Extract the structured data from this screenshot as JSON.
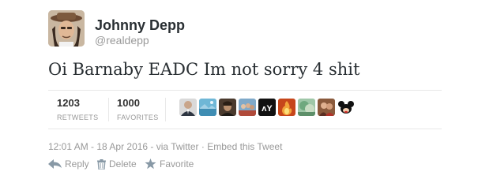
{
  "author": {
    "display_name": "Johnny Depp",
    "username": "@realdepp"
  },
  "tweet": {
    "text": "Oi Barnaby EADC Im not sorry 4 shit"
  },
  "stats": {
    "retweets_count": "1203",
    "retweets_label": "RETWEETS",
    "favorites_count": "1000",
    "favorites_label": "FAVORITES"
  },
  "facepile": [
    {
      "name": "face-avatar-1"
    },
    {
      "name": "face-avatar-2"
    },
    {
      "name": "face-avatar-3"
    },
    {
      "name": "face-avatar-4"
    },
    {
      "name": "face-avatar-5",
      "text": "ʌY"
    },
    {
      "name": "face-avatar-6"
    },
    {
      "name": "face-avatar-7"
    },
    {
      "name": "face-avatar-8"
    },
    {
      "name": "face-avatar-9"
    }
  ],
  "meta": {
    "timestamp": "12:01 AM - 18 Apr 2016",
    "via": " - via ",
    "source": "Twitter",
    "separator": " · ",
    "embed": "Embed this Tweet"
  },
  "actions": {
    "reply": "Reply",
    "delete": "Delete",
    "favorite": "Favorite"
  },
  "icons": {
    "reply": "reply-arrow-icon",
    "delete": "trash-icon",
    "favorite": "star-icon"
  },
  "colors": {
    "text": "#292f33",
    "muted": "#999999",
    "divider": "#e8e8e8"
  }
}
